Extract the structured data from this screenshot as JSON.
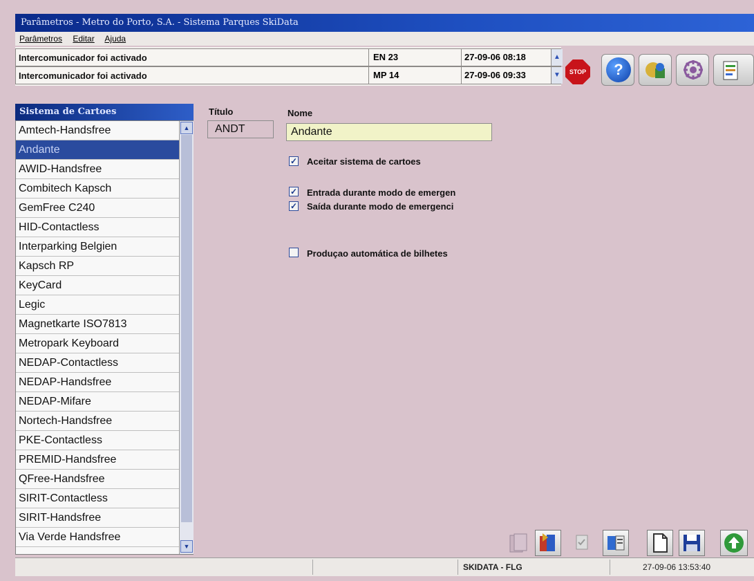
{
  "window": {
    "title": "Parâmetros - Metro do Porto, S.A. - Sistema Parques SkiData"
  },
  "menu": {
    "items": [
      "Parâmetros",
      "Editar",
      "Ajuda"
    ]
  },
  "alarms": [
    {
      "message": "Intercomunicador foi activado",
      "device": "EN 23",
      "datetime": "27-09-06 08:18"
    },
    {
      "message": "Intercomunicador foi activado",
      "device": "MP 14",
      "datetime": "27-09-06 09:33"
    }
  ],
  "toolbar": {
    "stop_label": "STOP",
    "help_label": "?"
  },
  "panel": {
    "title": "Sistema de Cartoes",
    "items": [
      "Amtech-Handsfree",
      "Andante",
      "AWID-Handsfree",
      "Combitech Kapsch",
      "GemFree C240",
      "HID-Contactless",
      "Interparking Belgien",
      "Kapsch RP",
      "KeyCard",
      "Legic",
      "Magnetkarte ISO7813",
      "Metropark Keyboard",
      "NEDAP-Contactless",
      "NEDAP-Handsfree",
      "NEDAP-Mifare",
      "Nortech-Handsfree",
      "PKE-Contactless",
      "PREMID-Handsfree",
      "QFree-Handsfree",
      "SIRIT-Contactless",
      "SIRIT-Handsfree",
      "Via Verde Handsfree"
    ],
    "selected": "Andante"
  },
  "form": {
    "titulo_label": "Título",
    "titulo_value": "ANDT",
    "nome_label": "Nome",
    "nome_value": "Andante",
    "options": [
      {
        "label": "Aceitar sistema de cartoes",
        "checked": true
      },
      {
        "label": "Entrada durante modo de emergen",
        "checked": true
      },
      {
        "label": "Saída durante modo de emergenci",
        "checked": true
      },
      {
        "label": "Produçao automática de bilhetes",
        "checked": false
      }
    ]
  },
  "statusbar": {
    "system": "SKIDATA - FLG",
    "datetime": "27-09-06 13:53:40"
  },
  "colors": {
    "background": "#d9c3cc",
    "titlebar": "#1e4fc0",
    "selection": "#2a4b9e",
    "nome_field": "#f1f3c8"
  }
}
